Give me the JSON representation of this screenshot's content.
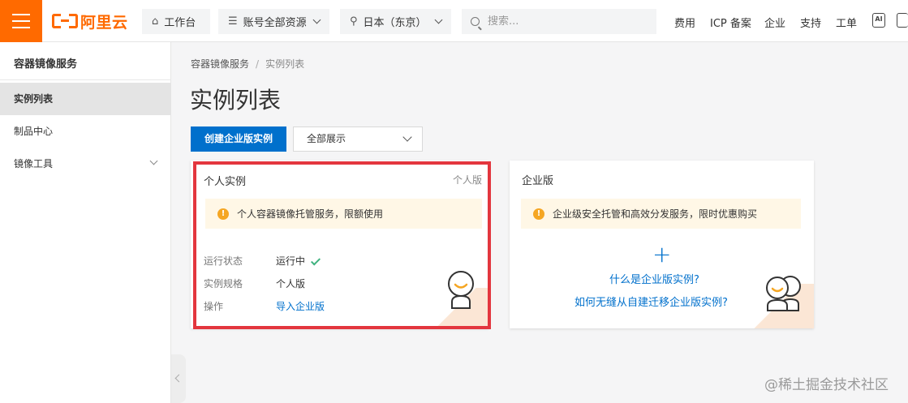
{
  "brand": {
    "logo_text": "阿里云",
    "accent": "#ff6a00"
  },
  "topbar": {
    "workbench_label": "工作台",
    "resources_label": "账号全部资源",
    "region_label": "日本（东京）",
    "search_placeholder": "搜索...",
    "links": [
      "费用",
      "ICP 备案",
      "企业",
      "支持",
      "工单"
    ]
  },
  "sidebar": {
    "title": "容器镜像服务",
    "items": [
      {
        "label": "实例列表",
        "active": true
      },
      {
        "label": "制品中心",
        "active": false
      },
      {
        "label": "镜像工具",
        "active": false,
        "expandable": true
      }
    ]
  },
  "breadcrumb": {
    "parent": "容器镜像服务",
    "separator": "/",
    "current": "实例列表"
  },
  "page": {
    "title": "实例列表",
    "create_button": "创建企业版实例",
    "filter_value": "全部展示"
  },
  "cards": {
    "personal": {
      "title": "个人实例",
      "tag": "个人版",
      "notice": "个人容器镜像托管服务，限额使用",
      "rows": [
        {
          "label": "运行状态",
          "value": "运行中"
        },
        {
          "label": "实例规格",
          "value": "个人版"
        },
        {
          "label": "操作",
          "value": "导入企业版"
        }
      ]
    },
    "enterprise": {
      "title": "企业版",
      "notice": "企业级安全托管和高效分发服务，限时优惠购买",
      "plus": "+",
      "link1": "什么是企业版实例?",
      "link2": "如何无缝从自建迁移企业版实例?"
    }
  },
  "watermark": "@稀土掘金技术社区",
  "colors": {
    "primary": "#0070cc",
    "highlight": "#e3363e",
    "warning": "#f5a623",
    "success": "#3fb27f"
  }
}
